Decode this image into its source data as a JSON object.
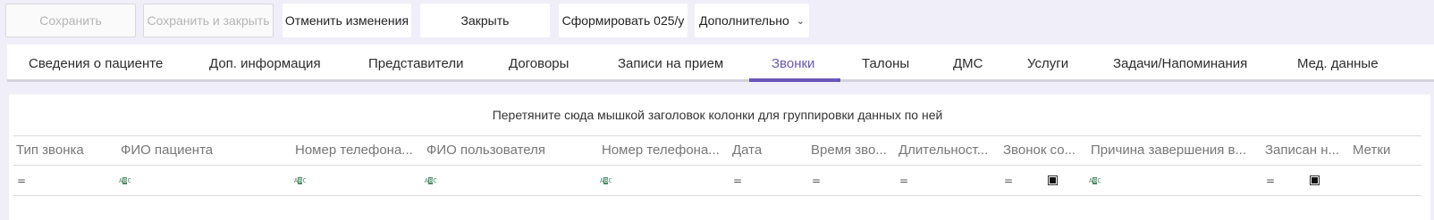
{
  "toolbar": {
    "save": "Сохранить",
    "save_close": "Сохранить и закрыть",
    "cancel_changes": "Отменить изменения",
    "close": "Закрыть",
    "form_025": "Сформировать 025/у",
    "more": "Дополнительно"
  },
  "tabs": [
    {
      "label": "Сведения о пациенте"
    },
    {
      "label": "Доп. информация"
    },
    {
      "label": "Представители"
    },
    {
      "label": "Договоры"
    },
    {
      "label": "Записи на прием"
    },
    {
      "label": "Звонки",
      "active": true
    },
    {
      "label": "Талоны"
    },
    {
      "label": "ДМС"
    },
    {
      "label": "Услуги"
    },
    {
      "label": "Задачи/Напоминания"
    },
    {
      "label": "Мед. данные"
    }
  ],
  "grid": {
    "group_hint": "Перетяните сюда мышкой заголовок колонки для группировки данных по ней",
    "columns": [
      "Тип звонка",
      "ФИО пациента",
      "Номер телефона...",
      "ФИО пользователя",
      "Номер телефона...",
      "Дата",
      "Время зво...",
      "Длительност...",
      "Звонок со...",
      "Причина завершения в...",
      "Записан н...",
      "Метки"
    ],
    "filter_icons": [
      "equals-icon",
      "text-filter-icon",
      "text-filter-icon",
      "text-filter-icon",
      "text-filter-icon",
      "equals-icon",
      "equals-icon",
      "equals-icon",
      "equals-icon",
      "text-filter-icon",
      "equals-icon"
    ],
    "filter_text_icon_label": "ABC"
  },
  "colors": {
    "accent": "#6a56b5",
    "background": "#efeef9"
  }
}
